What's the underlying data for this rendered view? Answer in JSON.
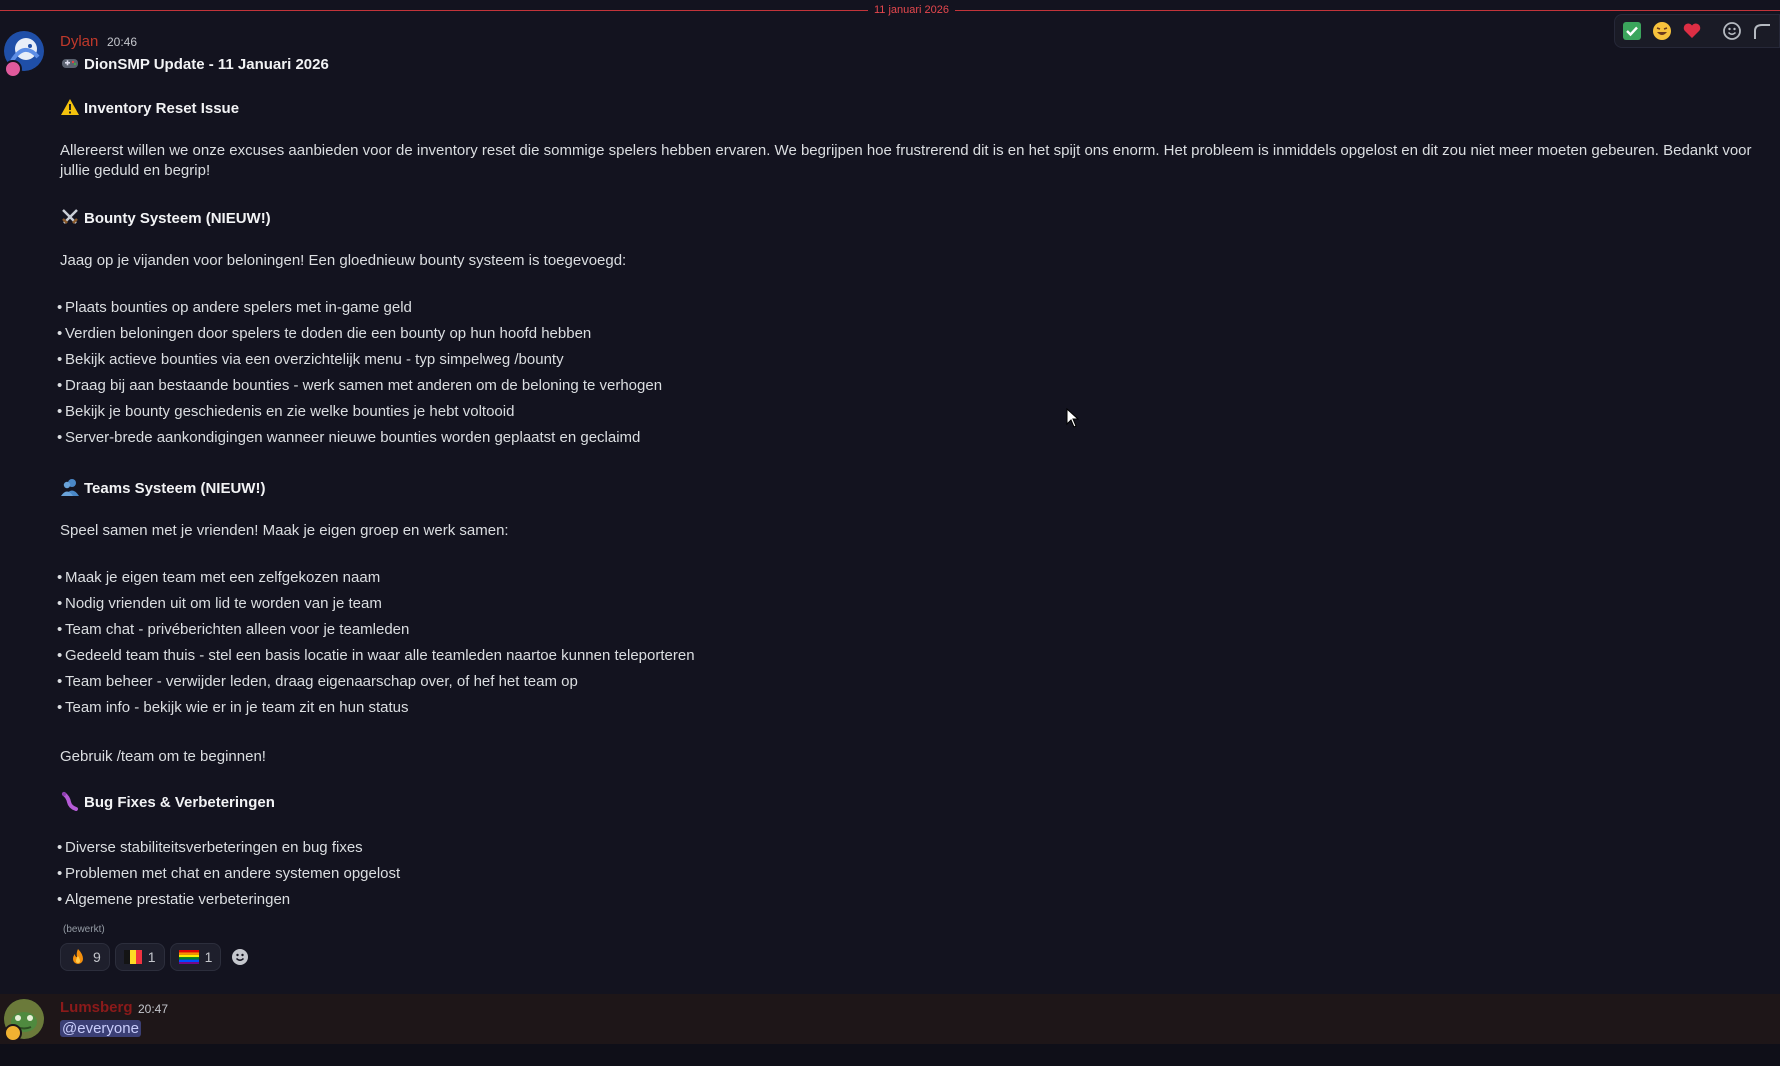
{
  "divider": {
    "date": "11 januari 2026"
  },
  "message1": {
    "author": "Dylan",
    "author_color": "#c0392b",
    "time": "20:46",
    "title": "DionSMP Update - 11 Januari 2026",
    "sections": {
      "inventory": {
        "heading": "Inventory Reset Issue",
        "text": "Allereerst willen we onze excuses aanbieden voor de inventory reset die sommige spelers hebben ervaren. We begrijpen hoe frustrerend dit is en het spijt ons enorm. Het probleem is inmiddels opgelost en dit zou niet meer moeten gebeuren. Bedankt voor jullie geduld en begrip!"
      },
      "bounty": {
        "heading": "Bounty Systeem (NIEUW!)",
        "intro": "Jaag op je vijanden voor beloningen! Een gloednieuw bounty systeem is toegevoegd:",
        "items": [
          "Plaats bounties op andere spelers met in-game geld",
          "Verdien beloningen door spelers te doden die een bounty op hun hoofd hebben",
          "Bekijk actieve bounties via een overzichtelijk menu - typ simpelweg /bounty",
          "Draag bij aan bestaande bounties - werk samen met anderen om de beloning te verhogen",
          "Bekijk je bounty geschiedenis en zie welke bounties je hebt voltooid",
          "Server-brede aankondigingen wanneer nieuwe bounties worden geplaatst en geclaimd"
        ]
      },
      "teams": {
        "heading": "Teams Systeem (NIEUW!)",
        "intro": "Speel samen met je vrienden! Maak je eigen groep en werk samen:",
        "items": [
          "Maak je eigen team met een zelfgekozen naam",
          "Nodig vrienden uit om lid te worden van je team",
          "Team chat - privéberichten alleen voor je teamleden",
          "Gedeeld team thuis - stel een basis locatie in waar alle teamleden naartoe kunnen teleporteren",
          "Team beheer - verwijder leden, draag eigenaarschap over, of hef het team op",
          "Team info - bekijk wie er in je team zit en hun status"
        ],
        "outro": "Gebruik /team om te beginnen!"
      },
      "bugs": {
        "heading": "Bug Fixes & Verbeteringen",
        "items": [
          "Diverse stabiliteitsverbeteringen en bug fixes",
          "Problemen met chat en andere systemen opgelost",
          "Algemene prestatie verbeteringen"
        ]
      }
    },
    "edited": "(bewerkt)",
    "reactions": [
      {
        "emoji": "fire",
        "count": "9"
      },
      {
        "emoji": "belgium-flag",
        "count": "1"
      },
      {
        "emoji": "rainbow-flag",
        "count": "1"
      }
    ]
  },
  "message2": {
    "author": "Lumsberg",
    "author_color": "#8b1a1a",
    "time": "20:47",
    "text": "@everyone"
  },
  "toolbar": [
    "check-mark",
    "laughing",
    "heart",
    "add-reaction",
    "reply"
  ]
}
